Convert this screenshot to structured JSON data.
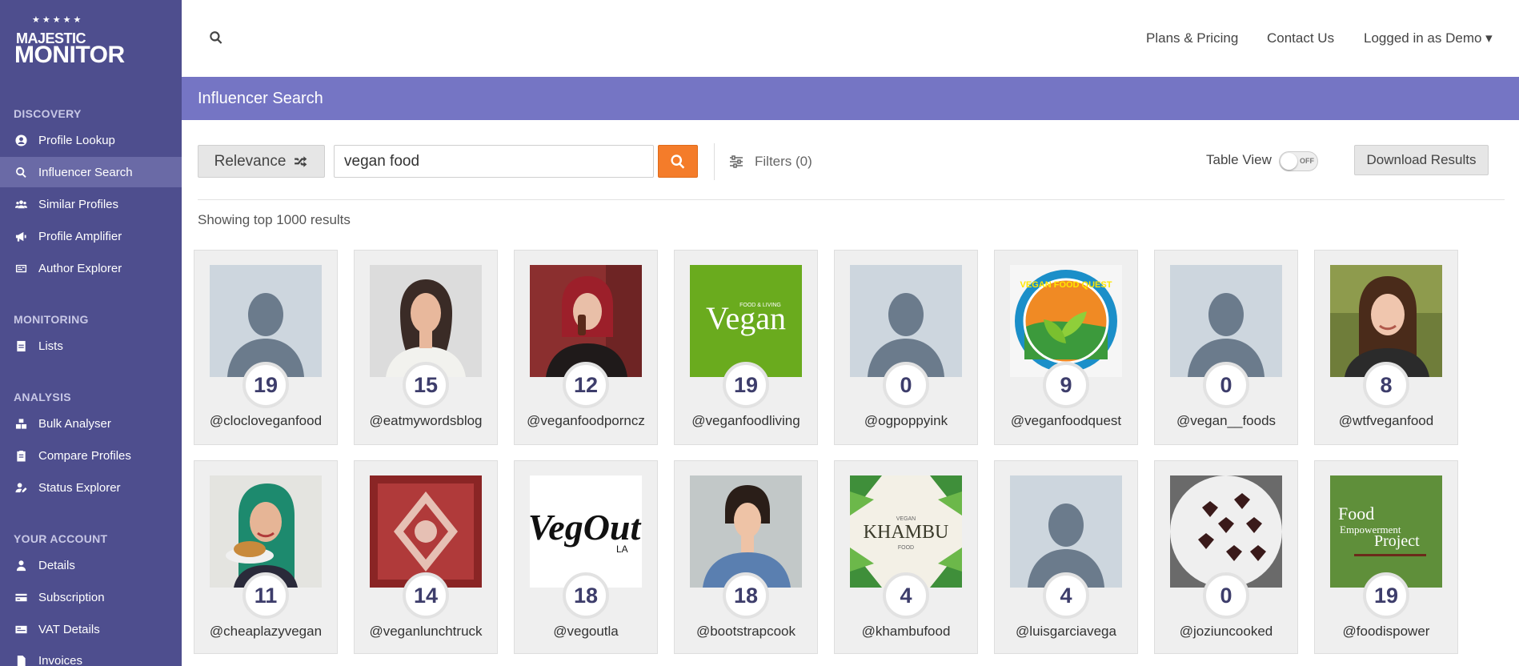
{
  "app": {
    "logo_line1": "MAJESTIC",
    "logo_line2": "MONITOR",
    "logo_stars": "★★★★★"
  },
  "sidebar": {
    "sections": [
      {
        "title": "DISCOVERY",
        "items": [
          {
            "label": "Profile Lookup",
            "icon": "user-circle-icon"
          },
          {
            "label": "Influencer Search",
            "icon": "search-icon",
            "active": true
          },
          {
            "label": "Similar Profiles",
            "icon": "users-icon"
          },
          {
            "label": "Profile Amplifier",
            "icon": "megaphone-icon"
          },
          {
            "label": "Author Explorer",
            "icon": "id-card-icon"
          }
        ]
      },
      {
        "title": "MONITORING",
        "items": [
          {
            "label": "Lists",
            "icon": "list-icon"
          }
        ]
      },
      {
        "title": "ANALYSIS",
        "items": [
          {
            "label": "Bulk Analyser",
            "icon": "bulk-icon"
          },
          {
            "label": "Compare Profiles",
            "icon": "clipboard-icon"
          },
          {
            "label": "Status Explorer",
            "icon": "user-edit-icon"
          }
        ]
      },
      {
        "title": "YOUR ACCOUNT",
        "items": [
          {
            "label": "Details",
            "icon": "user-icon"
          },
          {
            "label": "Subscription",
            "icon": "credit-card-icon"
          },
          {
            "label": "VAT Details",
            "icon": "receipt-icon"
          },
          {
            "label": "Invoices",
            "icon": "file-icon"
          }
        ]
      }
    ]
  },
  "topbar": {
    "plans": "Plans & Pricing",
    "contact": "Contact Us",
    "user": "Logged in as Demo",
    "user_caret": "▾"
  },
  "page": {
    "title": "Influencer Search"
  },
  "controls": {
    "sort_label": "Relevance",
    "search_value": "vegan food",
    "filters_label": "Filters (0)",
    "table_view_label": "Table View",
    "toggle_text": "OFF",
    "download_label": "Download Results"
  },
  "results": {
    "summary": "Showing top 1000 results",
    "cards": [
      {
        "handle": "@clocloveganfood",
        "score": "19",
        "avatar": "placeholder"
      },
      {
        "handle": "@eatmywordsblog",
        "score": "15",
        "avatar": "woman-grey"
      },
      {
        "handle": "@veganfoodporncz",
        "score": "12",
        "avatar": "woman-red"
      },
      {
        "handle": "@veganfoodliving",
        "score": "19",
        "avatar": "vegan-logo",
        "logo_small": "FOOD & LIVING",
        "logo_text": "Vegan"
      },
      {
        "handle": "@ogpoppyink",
        "score": "0",
        "avatar": "placeholder"
      },
      {
        "handle": "@veganfoodquest",
        "score": "9",
        "avatar": "quest-logo",
        "logo_text": "VEGAN FOOD QUEST"
      },
      {
        "handle": "@vegan__foods",
        "score": "0",
        "avatar": "placeholder"
      },
      {
        "handle": "@wtfveganfood",
        "score": "8",
        "avatar": "woman-smile"
      },
      {
        "handle": "@cheaplazyvegan",
        "score": "11",
        "avatar": "woman-green"
      },
      {
        "handle": "@veganlunchtruck",
        "score": "14",
        "avatar": "truck"
      },
      {
        "handle": "@vegoutla",
        "score": "18",
        "avatar": "vegout-logo",
        "logo_text": "VegOut",
        "logo_sub": "LA"
      },
      {
        "handle": "@bootstrapcook",
        "score": "18",
        "avatar": "person-denim"
      },
      {
        "handle": "@khambufood",
        "score": "4",
        "avatar": "khambu-logo",
        "logo_small": "VEGAN",
        "logo_text": "KHAMBU",
        "logo_sub": "FOOD"
      },
      {
        "handle": "@luisgarciavega",
        "score": "4",
        "avatar": "placeholder"
      },
      {
        "handle": "@joziuncooked",
        "score": "0",
        "avatar": "chocolates"
      },
      {
        "handle": "@foodispower",
        "score": "19",
        "avatar": "fep-logo",
        "logo_l1": "Food",
        "logo_l2": "Empowerment",
        "logo_l3": "Project"
      }
    ]
  },
  "colors": {
    "sidebar": "#4e4e8e",
    "band": "#7575c4",
    "accent": "#f47c2a",
    "score_text": "#3d3d6b"
  }
}
